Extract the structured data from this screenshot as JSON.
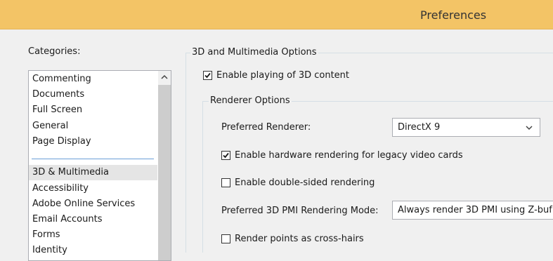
{
  "window": {
    "title": "Preferences"
  },
  "categories": {
    "label": "Categories:",
    "group1": [
      "Commenting",
      "Documents",
      "Full Screen",
      "General",
      "Page Display"
    ],
    "group2": [
      "3D & Multimedia",
      "Accessibility",
      "Adobe Online Services",
      "Email Accounts",
      "Forms",
      "Identity"
    ],
    "selected": "3D & Multimedia"
  },
  "panel": {
    "section_title": "3D and Multimedia Options",
    "enable_3d": {
      "label": "Enable playing of 3D content",
      "checked": true
    },
    "renderer_options": {
      "title": "Renderer Options",
      "preferred_renderer_label": "Preferred Renderer:",
      "preferred_renderer_value": "DirectX 9",
      "hw_rendering": {
        "label": "Enable hardware rendering for legacy video cards",
        "checked": true
      },
      "double_sided": {
        "label": "Enable double-sided rendering",
        "checked": false
      },
      "pmi_mode_label": "Preferred 3D PMI Rendering Mode:",
      "pmi_mode_value": "Always render 3D PMI using Z-buf",
      "crosshairs": {
        "label": "Render points as cross-hairs",
        "checked": false
      }
    }
  },
  "icons": {
    "scroll_up": "chevron-up-icon",
    "dropdown": "chevron-down-icon",
    "check": "checkmark-icon"
  }
}
